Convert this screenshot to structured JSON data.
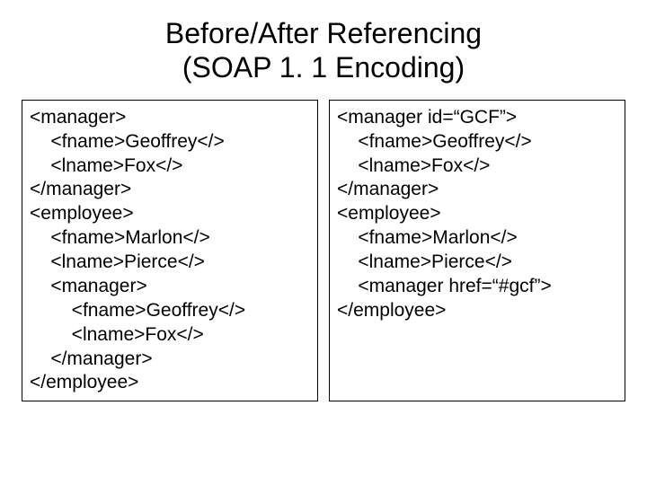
{
  "title_line1": "Before/After Referencing",
  "title_line2": "(SOAP 1. 1 Encoding)",
  "left_code": "<manager>\n    <fname>Geoffrey</>\n    <lname>Fox</>\n</manager>\n<employee>\n    <fname>Marlon</>\n    <lname>Pierce</>\n    <manager>\n        <fname>Geoffrey</>\n        <lname>Fox</>\n    </manager>\n</employee>",
  "right_code": "<manager id=“GCF”>\n    <fname>Geoffrey</>\n    <lname>Fox</>\n</manager>\n<employee>\n    <fname>Marlon</>\n    <lname>Pierce</>\n    <manager href=“#gcf”>\n</employee>"
}
